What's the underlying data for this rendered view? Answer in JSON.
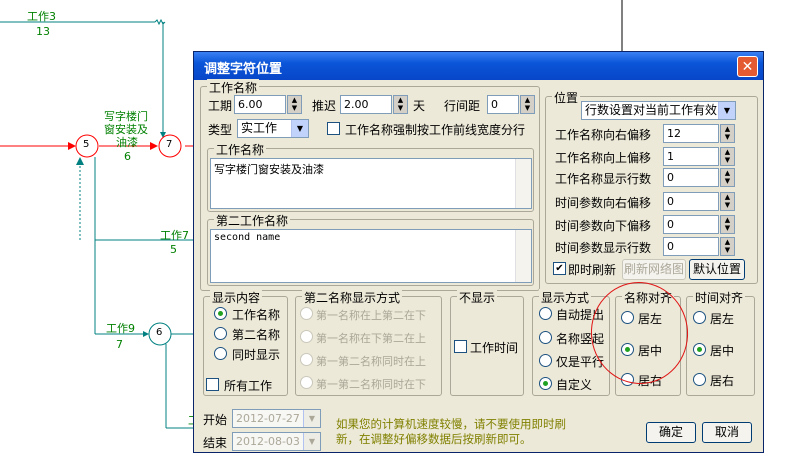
{
  "network": {
    "work3": {
      "name": "工作3",
      "duration": "13"
    },
    "work_main": {
      "name_lines": [
        "写字楼门",
        "窗安装及",
        "油漆"
      ],
      "duration": "6"
    },
    "work7": {
      "name": "工作7",
      "duration": "5"
    },
    "work9": {
      "name": "工作9",
      "duration": "7"
    },
    "nodes": {
      "n5": "5",
      "n7": "7",
      "n6": "6"
    },
    "partial_label": "工"
  },
  "dialog": {
    "title": "调整字符位置",
    "close_glyph": "✕",
    "work_name_group": {
      "legend": "工作名称",
      "period_label": "工期",
      "period_value": "6.00",
      "delay_label": "推迟",
      "delay_value": "2.00",
      "day_unit": "天",
      "spacing_label": "行间距",
      "spacing_value": "0",
      "type_label": "类型",
      "type_value": "实工作",
      "force_label": "工作名称强制按工作前线宽度分行",
      "name_legend": "工作名称",
      "name_value": "写字楼门窗安装及油漆",
      "second_legend": "第二工作名称",
      "second_value": "second name"
    },
    "position_group": {
      "legend": "位置",
      "mode_value": "行数设置对当前工作有效",
      "rows": [
        {
          "label": "工作名称向右偏移",
          "value": "12"
        },
        {
          "label": "工作名称向上偏移",
          "value": "1"
        },
        {
          "label": "工作名称显示行数",
          "value": "0"
        },
        {
          "label": "时间参数向右偏移",
          "value": "0"
        },
        {
          "label": "时间参数向下偏移",
          "value": "0"
        },
        {
          "label": "时间参数显示行数",
          "value": "0"
        }
      ],
      "instant_refresh": "即时刷新",
      "refresh_button": "刷新网络图",
      "default_button": "默认位置"
    },
    "display_content": {
      "legend": "显示内容",
      "options": [
        "工作名称",
        "第二名称",
        "同时显示"
      ],
      "selected": 0,
      "all_works": "所有工作"
    },
    "second_name_display": {
      "legend": "第二名称显示方式",
      "options": [
        "第一名称在上第二在下",
        "第一名称在下第二在上",
        "第一第二名称同时在上",
        "第一第二名称同时在下"
      ]
    },
    "hide": {
      "legend": "不显示",
      "work_time": "工作时间"
    },
    "display_mode": {
      "legend": "显示方式",
      "options": [
        "自动提出",
        "名称竖起",
        "仅是平行",
        "自定义"
      ],
      "selected": 3
    },
    "name_align": {
      "legend": "名称对齐",
      "options": [
        "居左",
        "居中",
        "居右"
      ],
      "selected": 1
    },
    "time_align": {
      "legend": "时间对齐",
      "options": [
        "居左",
        "居中",
        "居右"
      ],
      "selected": 1
    },
    "start_label": "开始",
    "start_value": "2012-07-27",
    "end_label": "结束",
    "end_value": "2012-08-03",
    "note_lines": [
      "如果您的计算机速度较慢，请不要使用即时刷",
      "新，在调整好偏移数据后按刷新即可。"
    ],
    "ok_button": "确定",
    "cancel_button": "取消"
  },
  "colors": {
    "titlebar": "#0a55d8",
    "dialog_bg": "#ece9d8",
    "arrow_red": "#ff0000",
    "line_green": "#008080",
    "annotation_red": "#e01515"
  }
}
